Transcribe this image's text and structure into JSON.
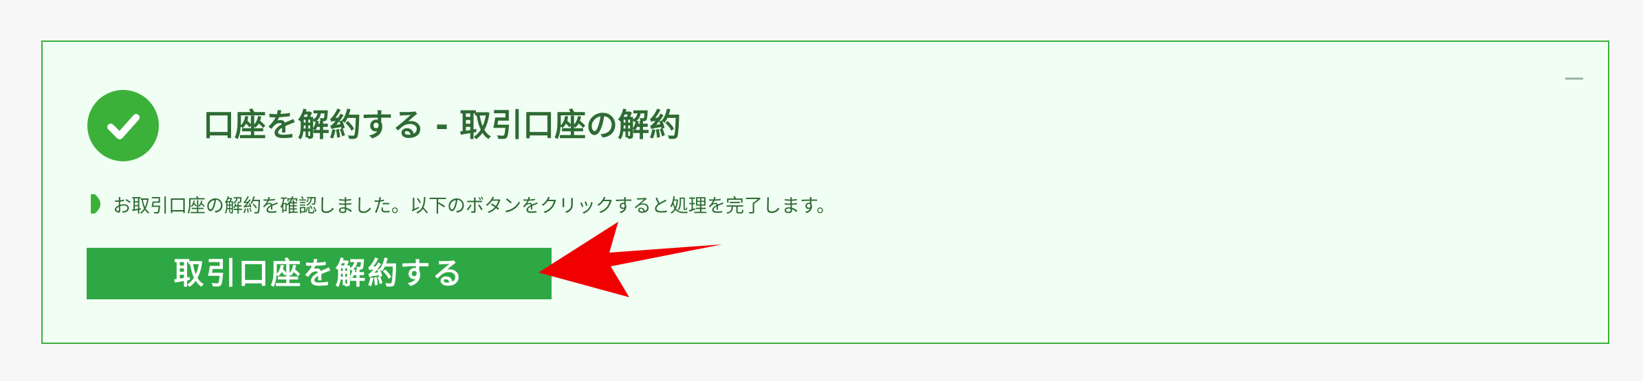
{
  "panel": {
    "title": "口座を解約する - 取引口座の解約",
    "notice": "お取引口座の解約を確認しました。以下のボタンをクリックすると処理を完了します。",
    "button_label": "取引口座を解約する",
    "minimize_icon": "minimize-icon",
    "status_icon": "checkmark-icon"
  },
  "colors": {
    "page_background": "#f7f7f7",
    "panel_background": "#f1fef3",
    "panel_border": "#3cb13a",
    "accent_green": "#3cb13a",
    "button_green": "#2ea845",
    "text_green": "#2e6b34",
    "arrow_red": "#f00000"
  }
}
